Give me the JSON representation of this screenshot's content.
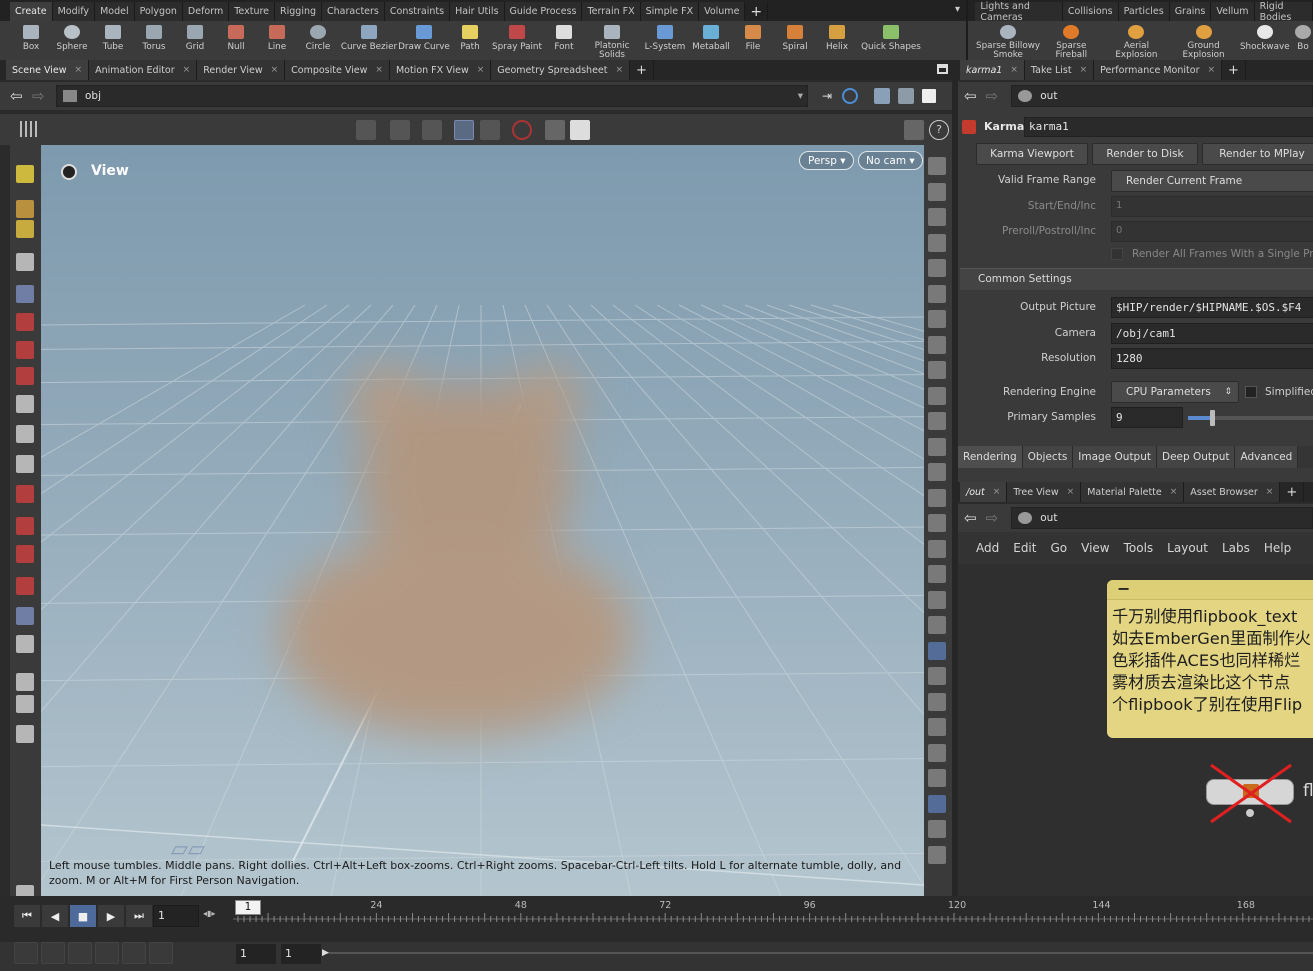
{
  "shelf_left": {
    "tabs": [
      "Create",
      "Modify",
      "Model",
      "Polygon",
      "Deform",
      "Texture",
      "Rigging",
      "Characters",
      "Constraints",
      "Hair Utils",
      "Guide Process",
      "Terrain FX",
      "Simple FX",
      "Volume"
    ],
    "add_tab": "+",
    "tools": [
      "Box",
      "Sphere",
      "Tube",
      "Torus",
      "Grid",
      "Null",
      "Line",
      "Circle",
      "Curve Bezier",
      "Draw Curve",
      "Path",
      "Spray Paint",
      "Font",
      "Platonic Solids",
      "L-System",
      "Metaball",
      "File",
      "Spiral",
      "Helix",
      "Quick Shapes"
    ],
    "menu_arrow": "▾"
  },
  "shelf_right": {
    "tabs": [
      "Lights and Cameras",
      "Collisions",
      "Particles",
      "Grains",
      "Vellum",
      "Rigid Bodies"
    ],
    "tools": [
      "Sparse Billowy Smoke",
      "Sparse Fireball",
      "Aerial Explosion",
      "Ground Explosion",
      "Shockwave",
      "Bo"
    ]
  },
  "left_pane": {
    "tabs": [
      "Scene View",
      "Animation Editor",
      "Render View",
      "Composite View",
      "Motion FX View",
      "Geometry Spreadsheet"
    ],
    "path": "obj",
    "view_label": "View",
    "persp_button": "Persp ▾",
    "cam_button": "No cam ▾",
    "help_text": "Left mouse tumbles. Middle pans. Right dollies. Ctrl+Alt+Left box-zooms. Ctrl+Right zooms. Spacebar-Ctrl-Left tilts. Hold L for alternate tumble, dolly, and zoom. M or Alt+M for First Person Navigation."
  },
  "param_pane": {
    "tabs": [
      "karma1",
      "Take List",
      "Performance Monitor"
    ],
    "path": "out",
    "node_type": "Karma",
    "node_name": "karma1",
    "buttons": [
      "Karma Viewport",
      "Render to Disk",
      "Render to MPlay"
    ],
    "valid_frame_range_label": "Valid Frame Range",
    "valid_frame_range_value": "Render Current Frame",
    "start_end_label": "Start/End/Inc",
    "start_end_value": "1",
    "preroll_label": "Preroll/Postroll/Inc",
    "preroll_value": "0",
    "render_all_frames": "Render All Frames With a Single Proc",
    "common_settings": "Common Settings",
    "output_picture_label": "Output Picture",
    "output_picture_value": "$HIP/render/$HIPNAME.$OS.$F4",
    "camera_label": "Camera",
    "camera_value": "/obj/cam1",
    "resolution_label": "Resolution",
    "resolution_value": "1280",
    "rendering_engine_label": "Rendering Engine",
    "rendering_engine_value": "CPU Parameters",
    "simplified_label": "Simplified",
    "primary_samples_label": "Primary Samples",
    "primary_samples_value": "9",
    "subtabs": [
      "Rendering",
      "Objects",
      "Image Output",
      "Deep Output",
      "Advanced"
    ]
  },
  "network_pane": {
    "tabs": [
      "/out",
      "Tree View",
      "Material Palette",
      "Asset Browser"
    ],
    "path": "out",
    "menu": [
      "Add",
      "Edit",
      "Go",
      "View",
      "Tools",
      "Layout",
      "Labs",
      "Help"
    ],
    "sticky_note": [
      "千万别使用flipbook_text",
      "如去EmberGen里面制作火",
      "色彩插件ACES也同样稀烂",
      "雾材质去渲染比这个节点",
      "个flipbook了别在使用Flip"
    ],
    "node_label": "fl"
  },
  "timeline": {
    "current_frame": "1",
    "marker": "1",
    "ticks": [
      "24",
      "48",
      "72",
      "96",
      "120",
      "144",
      "168"
    ],
    "range_start": "1",
    "range_end": "1"
  }
}
